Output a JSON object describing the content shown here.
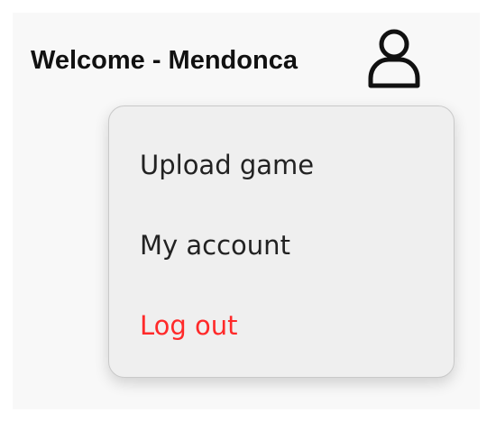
{
  "header": {
    "welcome_text": "Welcome - Mendonca"
  },
  "user_button": {
    "icon": "user-icon"
  },
  "menu": {
    "items": [
      {
        "label": "Upload game"
      },
      {
        "label": "My account"
      },
      {
        "label": "Log out"
      }
    ]
  },
  "colors": {
    "logout_text": "#ff2a2a",
    "menu_background": "#efefef",
    "page_panel": "#f8f8f8"
  }
}
